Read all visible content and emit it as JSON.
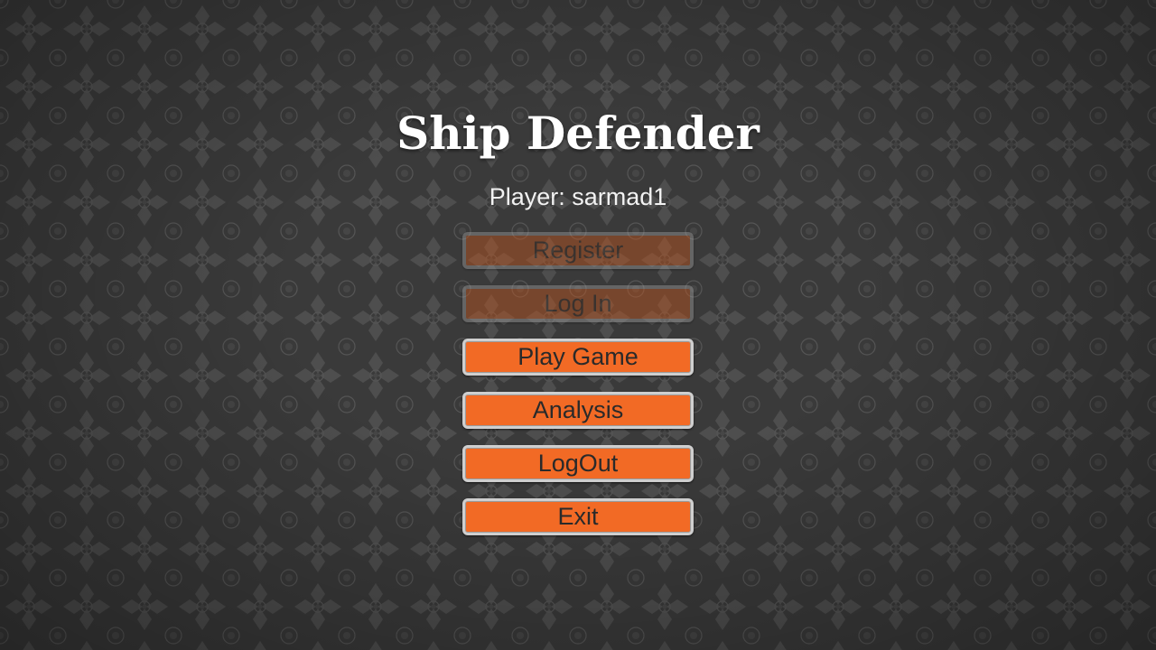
{
  "game": {
    "title": "Ship Defender",
    "player_line": "Player: sarmad1"
  },
  "menu": {
    "items": [
      {
        "label": "Register",
        "enabled": false
      },
      {
        "label": "Log In",
        "enabled": false
      },
      {
        "label": "Play Game",
        "enabled": true
      },
      {
        "label": "Analysis",
        "enabled": true
      },
      {
        "label": "LogOut",
        "enabled": true
      },
      {
        "label": "Exit",
        "enabled": true
      }
    ]
  },
  "colors": {
    "background": "#3c3c3c",
    "pattern": "#565656",
    "button_fill": "#f26a25",
    "button_border": "#cfcfcf",
    "title_text": "#ffffff"
  }
}
